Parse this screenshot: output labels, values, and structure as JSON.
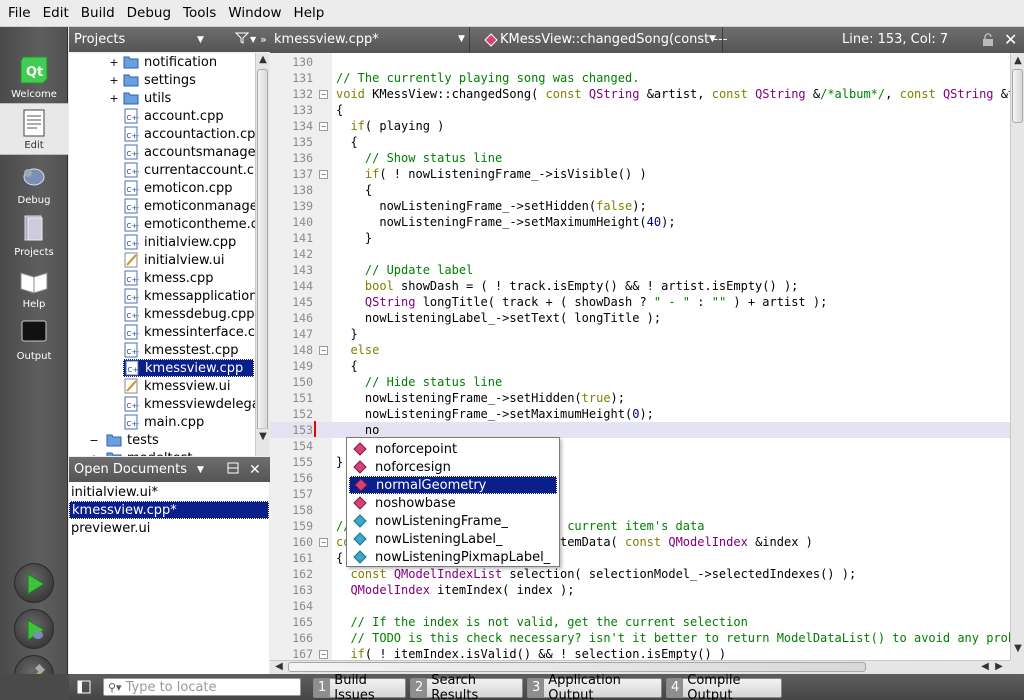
{
  "menu": [
    "File",
    "Edit",
    "Build",
    "Debug",
    "Tools",
    "Window",
    "Help"
  ],
  "modes": {
    "welcome": "Welcome",
    "edit": "Edit",
    "debug": "Debug",
    "projects": "Projects",
    "help": "Help",
    "output": "Output"
  },
  "projects_panel": {
    "title": "Projects"
  },
  "tree": [
    {
      "label": "notification",
      "kind": "folder",
      "exp": "+"
    },
    {
      "label": "settings",
      "kind": "folder",
      "exp": "+"
    },
    {
      "label": "utils",
      "kind": "folder",
      "exp": "+"
    },
    {
      "label": "account.cpp",
      "kind": "cpp"
    },
    {
      "label": "accountaction.cpp",
      "kind": "cpp"
    },
    {
      "label": "accountsmanager.",
      "kind": "cpp"
    },
    {
      "label": "currentaccount.cp",
      "kind": "cpp"
    },
    {
      "label": "emoticon.cpp",
      "kind": "cpp"
    },
    {
      "label": "emoticonmanager.",
      "kind": "cpp"
    },
    {
      "label": "emoticontheme.cp",
      "kind": "cpp"
    },
    {
      "label": "initialview.cpp",
      "kind": "cpp"
    },
    {
      "label": "initialview.ui",
      "kind": "ui"
    },
    {
      "label": "kmess.cpp",
      "kind": "cpp"
    },
    {
      "label": "kmessapplication.c",
      "kind": "cpp"
    },
    {
      "label": "kmessdebug.cpp",
      "kind": "cpp"
    },
    {
      "label": "kmessinterface.cp",
      "kind": "cpp"
    },
    {
      "label": "kmesstest.cpp",
      "kind": "cpp"
    },
    {
      "label": "kmessview.cpp",
      "kind": "cpp",
      "selected": true
    },
    {
      "label": "kmessview.ui",
      "kind": "ui"
    },
    {
      "label": "kmessviewdelegat",
      "kind": "cpp"
    },
    {
      "label": "main.cpp",
      "kind": "cpp"
    },
    {
      "label": "tests",
      "kind": "folder",
      "exp": "−",
      "level": 0
    },
    {
      "label": "modeltest",
      "kind": "folder",
      "exp": "+",
      "level": 0
    }
  ],
  "open_documents": {
    "title": "Open Documents",
    "items": [
      "initialview.ui*",
      "kmessview.cpp*",
      "previewer.ui"
    ],
    "selected": 1
  },
  "editor_header": {
    "file": "kmessview.cpp*",
    "symbol": "KMessView::changedSong(const ---",
    "position": "Line: 153, Col: 7"
  },
  "code": [
    {
      "n": "130",
      "html": ""
    },
    {
      "n": "131",
      "html": "<span class='cm'>// The currently playing song was changed.</span>"
    },
    {
      "n": "132",
      "fold": "−",
      "html": "<span class='kw'>void</span> KMessView::changedSong( <span class='kw'>const</span> <span class='ty'>QString</span> &amp;artist, <span class='kw'>const</span> <span class='ty'>QString</span> &amp;<span class='cm'>/*album*/</span>, <span class='kw'>const</span> <span class='ty'>QString</span> &amp;tra"
    },
    {
      "n": "133",
      "html": "{"
    },
    {
      "n": "134",
      "fold": "−",
      "html": "  <span class='kw'>if</span>( playing )"
    },
    {
      "n": "135",
      "html": "  {"
    },
    {
      "n": "136",
      "html": "    <span class='cm'>// Show status line</span>"
    },
    {
      "n": "137",
      "fold": "−",
      "html": "    <span class='kw'>if</span>( ! nowListeningFrame_-&gt;isVisible() )"
    },
    {
      "n": "138",
      "html": "    {"
    },
    {
      "n": "139",
      "html": "      nowListeningFrame_-&gt;setHidden(<span class='kw'>false</span>);"
    },
    {
      "n": "140",
      "html": "      nowListeningFrame_-&gt;setMaximumHeight(<span class='nm'>40</span>);"
    },
    {
      "n": "141",
      "html": "    }"
    },
    {
      "n": "142",
      "html": ""
    },
    {
      "n": "143",
      "html": "    <span class='cm'>// Update label</span>"
    },
    {
      "n": "144",
      "html": "    <span class='kw'>bool</span> showDash = ( ! track.isEmpty() &amp;&amp; ! artist.isEmpty() );"
    },
    {
      "n": "145",
      "html": "    <span class='ty'>QString</span> longTitle( track + ( showDash ? <span class='st'>\" - \"</span> : <span class='st'>\"\"</span> ) + artist );"
    },
    {
      "n": "146",
      "html": "    nowListeningLabel_-&gt;setText( longTitle );"
    },
    {
      "n": "147",
      "html": "  }"
    },
    {
      "n": "148",
      "fold": "−",
      "html": "  <span class='kw'>else</span>"
    },
    {
      "n": "149",
      "html": "  {"
    },
    {
      "n": "150",
      "html": "    <span class='cm'>// Hide status line</span>"
    },
    {
      "n": "151",
      "html": "    nowListeningFrame_-&gt;setHidden(<span class='kw'>true</span>);"
    },
    {
      "n": "152",
      "html": "    nowListeningFrame_-&gt;setMaximumHeight(<span class='nm'>0</span>);"
    },
    {
      "n": "153",
      "html": "    no",
      "current": true
    },
    {
      "n": "154",
      "html": ""
    },
    {
      "n": "155",
      "html": "}"
    },
    {
      "n": "156",
      "html": ""
    },
    {
      "n": "157",
      "html": ""
    },
    {
      "n": "158",
      "html": ""
    },
    {
      "n": "159",
      "html": "<span class='cm'>//                           he current item's data</span>"
    },
    {
      "n": "160",
      "fold": "−",
      "html": "<span class='kw'>co</span>                          etItemData( <span class='kw'>const</span> <span class='ty'>QModelIndex</span> &amp;index )"
    },
    {
      "n": "161",
      "html": "{"
    },
    {
      "n": "162",
      "html": "  <span class='kw'>const</span> <span class='ty'>QModelIndexList</span> selection( selectionModel_-&gt;selectedIndexes() );"
    },
    {
      "n": "163",
      "html": "  <span class='ty'>QModelIndex</span> itemIndex( index );"
    },
    {
      "n": "164",
      "html": ""
    },
    {
      "n": "165",
      "html": "  <span class='cm'>// If the index is not valid, get the current selection</span>"
    },
    {
      "n": "166",
      "html": "  <span class='cm'>// TODO is this check necessary? isn't it better to return ModelDataList() to avoid any proble</span>"
    },
    {
      "n": "167",
      "fold": "−",
      "html": "  <span class='kw'>if</span>( ! itemIndex.isValid() &amp;&amp; ! selection.isEmpty() )"
    }
  ],
  "completion": [
    {
      "label": "noforcepoint",
      "kind": "function"
    },
    {
      "label": "noforcesign",
      "kind": "function"
    },
    {
      "label": "normalGeometry",
      "kind": "function",
      "selected": true
    },
    {
      "label": "noshowbase",
      "kind": "function"
    },
    {
      "label": "nowListeningFrame_",
      "kind": "member"
    },
    {
      "label": "nowListeningLabel_",
      "kind": "member"
    },
    {
      "label": "nowListeningPixmapLabel_",
      "kind": "member"
    }
  ],
  "statusbar": {
    "locate_placeholder": "Type to locate",
    "tabs": [
      {
        "num": "1",
        "label": "Build Issues"
      },
      {
        "num": "2",
        "label": "Search Results"
      },
      {
        "num": "3",
        "label": "Application Output"
      },
      {
        "num": "4",
        "label": "Compile Output"
      }
    ]
  },
  "colors": {
    "selection": "#0a1f8a",
    "comment": "#008000",
    "keyword": "#808000",
    "type": "#800080",
    "number": "#000080"
  }
}
